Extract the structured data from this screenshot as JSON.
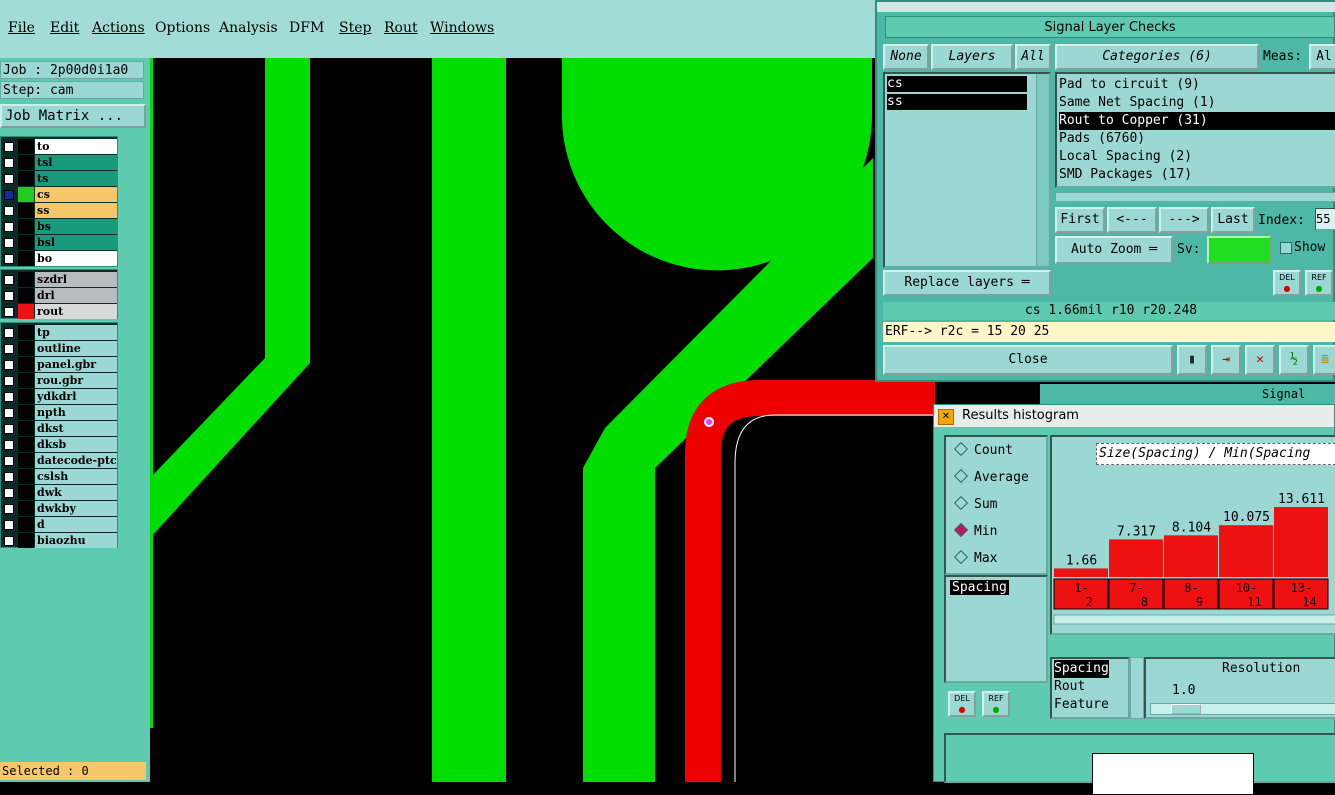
{
  "menu": [
    "File",
    "Edit",
    "Actions",
    "Options",
    "Analysis",
    "DFM",
    "Step",
    "Rout",
    "Windows"
  ],
  "job": {
    "job_line": "Job : 2p00d0i1a0",
    "step_line": "Step: cam",
    "matrix_button": "Job Matrix ..."
  },
  "layers": {
    "group1": [
      {
        "name": "to",
        "bg": "#ffffff",
        "swatch": "#000000"
      },
      {
        "name": "tsl",
        "bg": "#1a9a7c",
        "swatch": "#000000"
      },
      {
        "name": "ts",
        "bg": "#1a9a7c",
        "swatch": "#000000"
      },
      {
        "name": "cs",
        "bg": "#f6c86a",
        "swatch": "#22cc22"
      },
      {
        "name": "ss",
        "bg": "#f6c86a",
        "swatch": "#000000"
      },
      {
        "name": "bs",
        "bg": "#1a9a7c",
        "swatch": "#000000"
      },
      {
        "name": "bsl",
        "bg": "#1a9a7c",
        "swatch": "#000000"
      },
      {
        "name": "bo",
        "bg": "#ffffff",
        "swatch": "#000000"
      }
    ],
    "group2": [
      {
        "name": "szdrl",
        "bg": "#b7bcc0",
        "swatch": "#000000"
      },
      {
        "name": "drl",
        "bg": "#b7bcc0",
        "swatch": "#000000"
      },
      {
        "name": "rout",
        "bg": "#d9d9d9",
        "swatch": "#ee1111"
      }
    ],
    "group3": [
      {
        "name": "tp",
        "bg": "#9bd8d3",
        "swatch": "#000000"
      },
      {
        "name": "outline",
        "bg": "#9bd8d3",
        "swatch": "#000000"
      },
      {
        "name": "panel.gbr",
        "bg": "#9bd8d3",
        "swatch": "#000000"
      },
      {
        "name": "rou.gbr",
        "bg": "#9bd8d3",
        "swatch": "#000000"
      },
      {
        "name": "ydkdrl",
        "bg": "#9bd8d3",
        "swatch": "#000000"
      },
      {
        "name": "npth",
        "bg": "#9bd8d3",
        "swatch": "#000000"
      },
      {
        "name": "dkst",
        "bg": "#9bd8d3",
        "swatch": "#000000"
      },
      {
        "name": "dksb",
        "bg": "#9bd8d3",
        "swatch": "#000000"
      },
      {
        "name": "datecode-ptc",
        "bg": "#9bd8d3",
        "swatch": "#000000"
      },
      {
        "name": "cslsh",
        "bg": "#9bd8d3",
        "swatch": "#000000"
      },
      {
        "name": "dwk",
        "bg": "#9bd8d3",
        "swatch": "#000000"
      },
      {
        "name": "dwkby",
        "bg": "#9bd8d3",
        "swatch": "#000000"
      },
      {
        "name": "d",
        "bg": "#9bd8d3",
        "swatch": "#000000"
      },
      {
        "name": "biaozhu",
        "bg": "#9bd8d3",
        "swatch": "#000000"
      }
    ]
  },
  "selected": "Selected : 0",
  "checks": {
    "title": "Signal Layer Checks",
    "none_button": "None",
    "layers_button": "Layers",
    "all_button": "All",
    "layer_list": [
      "cs",
      "ss"
    ],
    "categories_button": "Categories (6)",
    "meas_label": "Meas:",
    "meas_value": "Al",
    "categories": [
      {
        "label": "Pad to circuit (9)",
        "selected": false
      },
      {
        "label": "Same Net Spacing (1)",
        "selected": false
      },
      {
        "label": "Rout to Copper (31)",
        "selected": true
      },
      {
        "label": "Pads (6760)",
        "selected": false
      },
      {
        "label": "Local Spacing (2)",
        "selected": false
      },
      {
        "label": "SMD Packages (17)",
        "selected": false
      }
    ],
    "first_button": "First",
    "prev_button": "<---",
    "next_button": "--->",
    "last_button": "Last",
    "index_label": "Index:",
    "index_value": "55",
    "auto_zoom_button": "Auto Zoom",
    "sv_label": "Sv:",
    "show_label": "Show",
    "replace_layers_button": "Replace layers",
    "del_label": "DEL",
    "ref_label": "REF",
    "status": "cs 1.66mil  r10  r20.248",
    "erf": "ERF--> r2c = 15 20 25",
    "close_button": "Close",
    "bg_window_partial": "Signal"
  },
  "histogram": {
    "title": "Results histogram",
    "radios": [
      {
        "label": "Count",
        "on": false
      },
      {
        "label": "Average",
        "on": false
      },
      {
        "label": "Sum",
        "on": false
      },
      {
        "label": "Min",
        "on": true
      },
      {
        "label": "Max",
        "on": false
      }
    ],
    "attr_list": [
      "Spacing"
    ],
    "del_label": "DEL",
    "ref_label": "REF",
    "chart_header": "Size(Spacing) / Min(Spacing",
    "bottom_list": [
      "Spacing",
      "Rout",
      "Feature"
    ],
    "resolution_label": "Resolution",
    "resolution_value": "1.0"
  },
  "chart_data": {
    "type": "bar",
    "categories": [
      "1-2",
      "7-8",
      "8-9",
      "10-11",
      "13-14"
    ],
    "values": [
      1.66,
      7.317,
      8.104,
      10.075,
      13.611
    ],
    "title": "Size(Spacing) / Min(Spacing",
    "colors": {
      "bar": "#ee1111"
    }
  },
  "colors": {
    "menubar": "#a2dcd6",
    "panel": "#5ecbb0",
    "copper": "#00dd00",
    "rout": "#ee0000"
  }
}
